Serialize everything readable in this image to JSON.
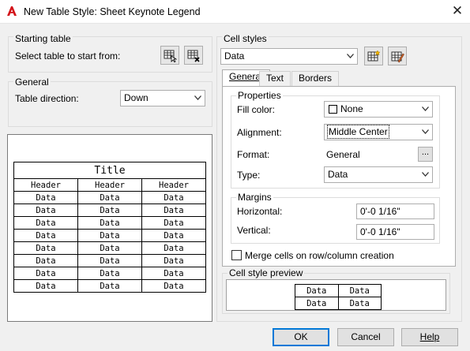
{
  "window": {
    "title": "New Table Style: Sheet Keynote Legend",
    "icon": "autocad-a-icon"
  },
  "starting_table": {
    "group_label": "Starting table",
    "select_label": "Select table to start from:",
    "select_icon": "select-table-icon",
    "remove_icon": "remove-table-icon"
  },
  "general": {
    "group_label": "General",
    "direction_label": "Table direction:",
    "direction_value": "Down"
  },
  "table_preview": {
    "title": "Title",
    "headers": [
      "Header",
      "Header",
      "Header"
    ],
    "rows": [
      [
        "Data",
        "Data",
        "Data"
      ],
      [
        "Data",
        "Data",
        "Data"
      ],
      [
        "Data",
        "Data",
        "Data"
      ],
      [
        "Data",
        "Data",
        "Data"
      ],
      [
        "Data",
        "Data",
        "Data"
      ],
      [
        "Data",
        "Data",
        "Data"
      ],
      [
        "Data",
        "Data",
        "Data"
      ],
      [
        "Data",
        "Data",
        "Data"
      ]
    ]
  },
  "cell_styles": {
    "group_label": "Cell styles",
    "selected": "Data",
    "new_style_icon": "new-cell-style-icon",
    "manage_icon": "manage-cell-styles-icon",
    "tabs": [
      "General",
      "Text",
      "Borders"
    ],
    "active_tab": "General",
    "properties": {
      "group_label": "Properties",
      "fill_label": "Fill color:",
      "fill_value": "None",
      "alignment_label": "Alignment:",
      "alignment_value": "Middle Center",
      "format_label": "Format:",
      "format_value": "General",
      "format_button": "...",
      "type_label": "Type:",
      "type_value": "Data"
    },
    "margins": {
      "group_label": "Margins",
      "horizontal_label": "Horizontal:",
      "horizontal_value": "0'-0 1/16\"",
      "vertical_label": "Vertical:",
      "vertical_value": "0'-0 1/16\""
    },
    "merge_label": "Merge cells on row/column creation",
    "merge_checked": false,
    "preview_label": "Cell style preview",
    "preview_cells": [
      [
        "Data",
        "Data"
      ],
      [
        "Data",
        "Data"
      ]
    ]
  },
  "buttons": {
    "ok": "OK",
    "cancel": "Cancel",
    "help": "Help"
  }
}
